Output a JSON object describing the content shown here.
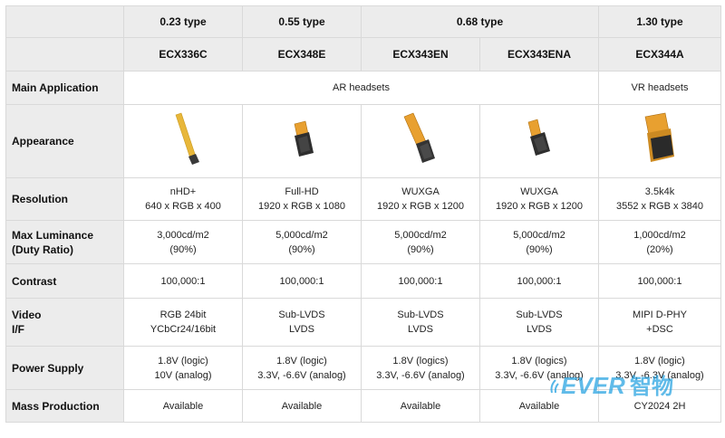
{
  "sizes": {
    "t023": "0.23 type",
    "t055": "0.55 type",
    "t068": "0.68 type",
    "t130": "1.30 type"
  },
  "models": [
    "ECX336C",
    "ECX348E",
    "ECX343EN",
    "ECX343ENA",
    "ECX344A"
  ],
  "rows": {
    "main_application": {
      "label": "Main Application",
      "ar": "AR headsets",
      "vr": "VR headsets"
    },
    "appearance": {
      "label": "Appearance"
    },
    "resolution": {
      "label": "Resolution",
      "cells": [
        [
          "nHD+",
          "640 x RGB x 400"
        ],
        [
          "Full-HD",
          "1920 x RGB x 1080"
        ],
        [
          "WUXGA",
          "1920 x RGB x 1200"
        ],
        [
          "WUXGA",
          "1920 x RGB x 1200"
        ],
        [
          "3.5k4k",
          "3552 x RGB x 3840"
        ]
      ]
    },
    "luminance": {
      "label1": "Max Luminance",
      "label2": "(Duty Ratio)",
      "cells": [
        [
          "3,000cd/m2",
          "(90%)"
        ],
        [
          "5,000cd/m2",
          "(90%)"
        ],
        [
          "5,000cd/m2",
          "(90%)"
        ],
        [
          "5,000cd/m2",
          "(90%)"
        ],
        [
          "1,000cd/m2",
          "(20%)"
        ]
      ]
    },
    "contrast": {
      "label": "Contrast",
      "cells": [
        "100,000:1",
        "100,000:1",
        "100,000:1",
        "100,000:1",
        "100,000:1"
      ]
    },
    "video": {
      "label1": "Video",
      "label2": "I/F",
      "cells": [
        [
          "RGB 24bit",
          "YCbCr24/16bit"
        ],
        [
          "Sub-LVDS",
          "LVDS"
        ],
        [
          "Sub-LVDS",
          "LVDS"
        ],
        [
          "Sub-LVDS",
          "LVDS"
        ],
        [
          "MIPI D-PHY",
          "+DSC"
        ]
      ]
    },
    "power": {
      "label": "Power Supply",
      "cells": [
        [
          "1.8V (logic)",
          "10V (analog)"
        ],
        [
          "1.8V (logic)",
          "3.3V, -6.6V (analog)"
        ],
        [
          "1.8V (logics)",
          "3.3V, -6.6V (analog)"
        ],
        [
          "1.8V (logics)",
          "3.3V, -6.6V (analog)"
        ],
        [
          "1.8V (logic)",
          "3.3V, -6.3V (analog)"
        ]
      ]
    },
    "mass_production": {
      "label": "Mass Production",
      "cells": [
        "Available",
        "Available",
        "Available",
        "Available",
        "CY2024 2H"
      ]
    }
  },
  "watermark": {
    "text_latin": "EVER",
    "text_cjk": "智物",
    "color": "#1e9fe0"
  },
  "colors": {
    "header_bg": "#ececec",
    "border": "#d9d9d9",
    "flex_cable": "#e8b73a",
    "chip": "#3a3a3a"
  }
}
